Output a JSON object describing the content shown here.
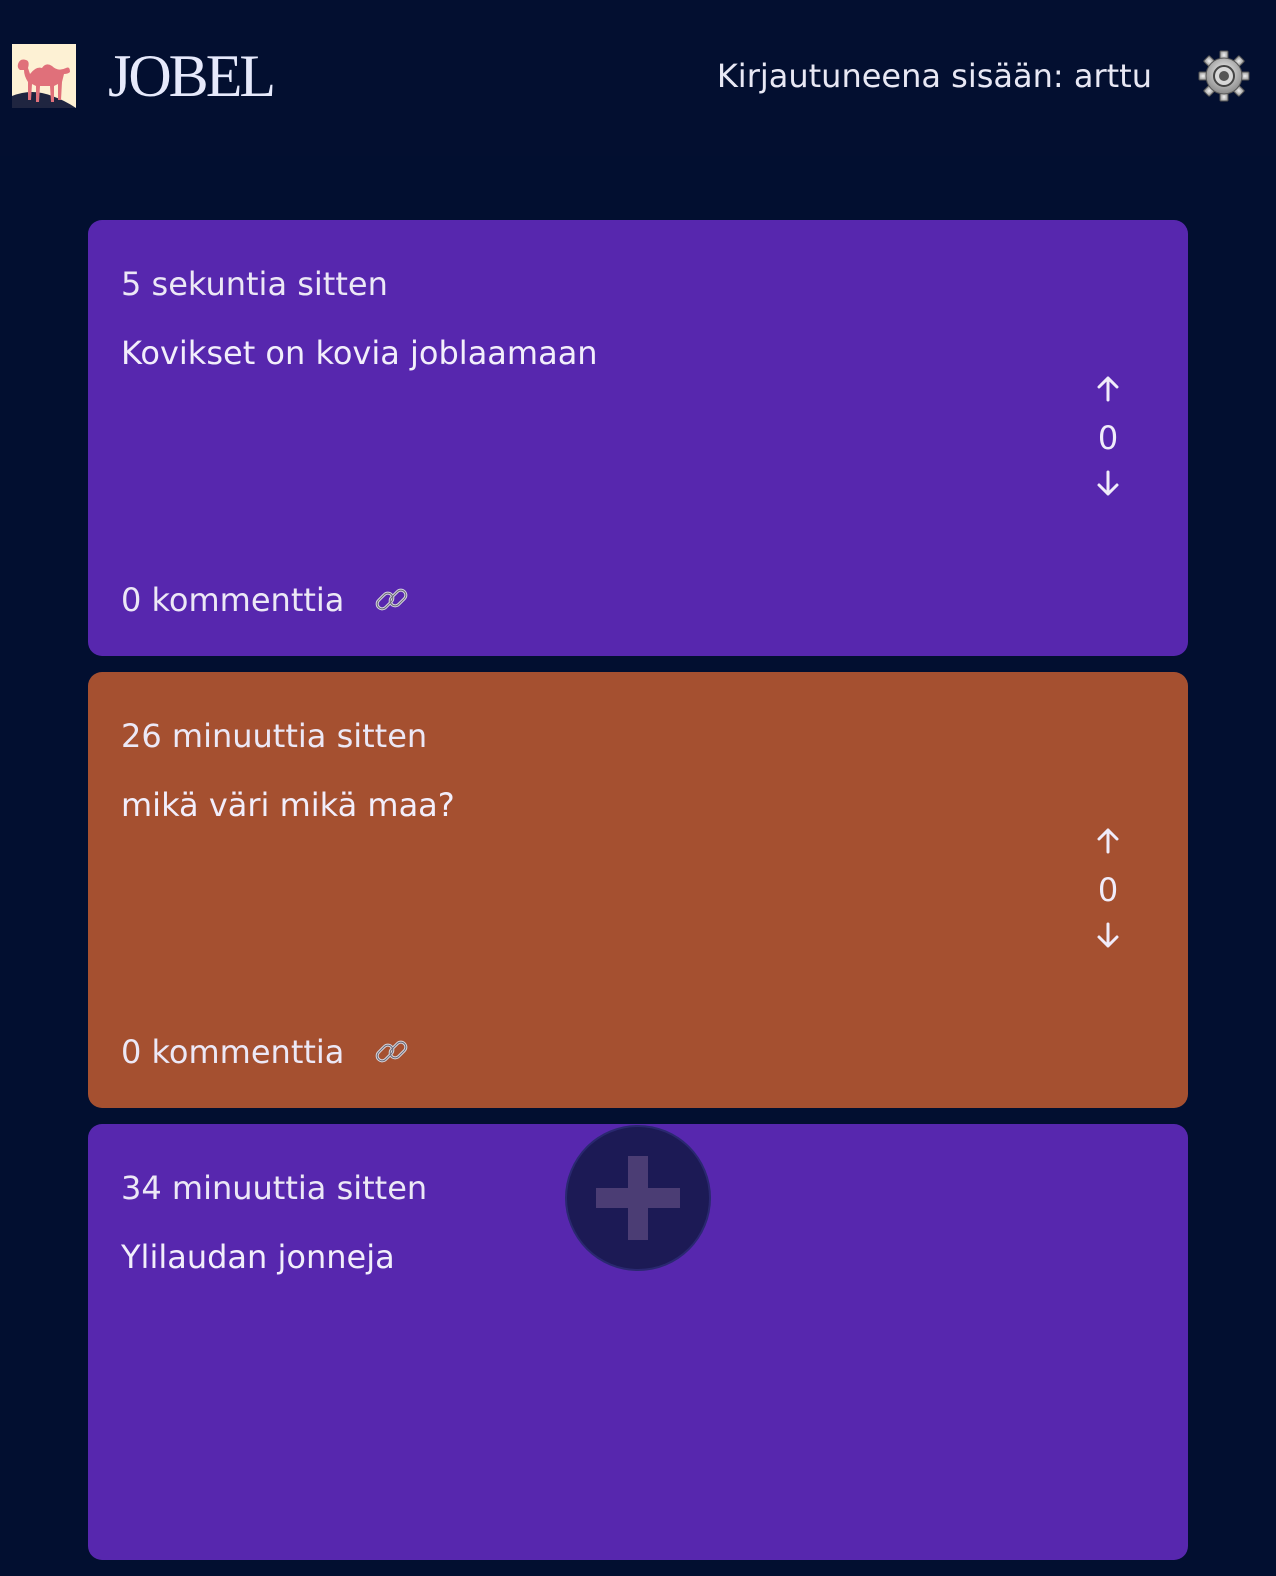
{
  "header": {
    "brand": "JOBEL",
    "login_status": "Kirjautuneena sisään: arttu"
  },
  "posts": [
    {
      "time": "5 sekuntia sitten",
      "text": "Kovikset on kovia joblaamaan",
      "score": "0",
      "comments": "0 kommenttia",
      "color": "#5727ae"
    },
    {
      "time": "26 minuuttia sitten",
      "text": "mikä väri mikä maa?",
      "score": "0",
      "comments": "0 kommenttia",
      "color": "#a55030"
    },
    {
      "time": "34 minuuttia sitten",
      "text": "Ylilaudan jonneja",
      "color": "#5727ae"
    }
  ],
  "icons": {
    "logo": "camel-logo",
    "settings": "gear-icon",
    "upvote": "arrow-up-icon",
    "downvote": "arrow-down-icon",
    "link": "link-icon",
    "fab": "plus-icon"
  },
  "colors": {
    "background": "#020f30",
    "fab": "#1c1a55"
  }
}
